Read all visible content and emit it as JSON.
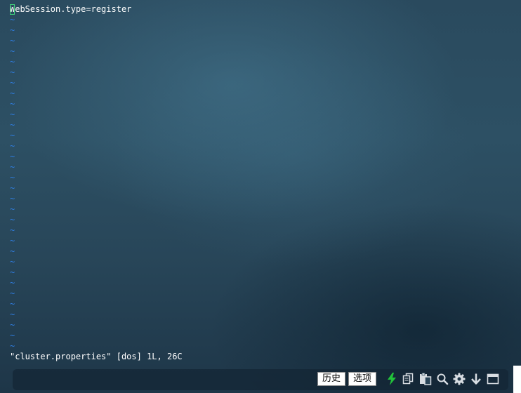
{
  "editor": {
    "first_line_cursor_char": "W",
    "first_line_rest": "ebSession.type=register",
    "tilde_char": "~",
    "tilde_count": 32
  },
  "status_line": "\"cluster.properties\" [dos] 1L, 26C",
  "toolbar": {
    "history_label": "历史",
    "options_label": "选项",
    "icons": [
      "lightning-icon",
      "copy-icon",
      "paste-icon",
      "search-icon",
      "gear-icon",
      "download-arrow-icon",
      "window-maximize-icon"
    ],
    "accent_color": "#22c23a"
  }
}
